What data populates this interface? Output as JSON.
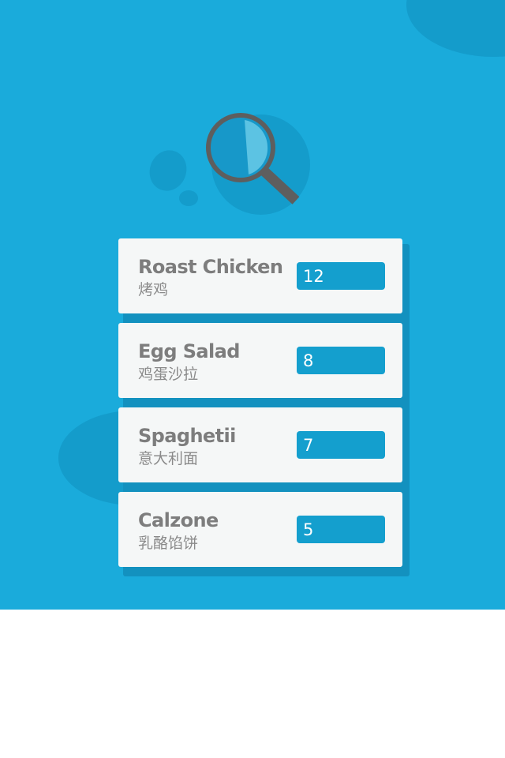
{
  "colors": {
    "background": "#ffffff",
    "hero_background": "#1aabdb",
    "blob": "#149ccb",
    "card_background": "#f5f7f7",
    "card_shadow": "#1391bf",
    "card_title_text": "#7d7d7d",
    "card_subtitle_text": "#8a8a8a",
    "field_background": "#149fce",
    "field_text": "#ffffff",
    "magnifier_frame": "#5e5e5e",
    "magnifier_glass": "#1798c9",
    "magnifier_glare": "#5cc3e3"
  },
  "icons": {
    "magnifier": "magnifying-glass-icon"
  },
  "items": [
    {
      "name": "Roast Chicken",
      "subname": "烤鸡",
      "quantity": "12"
    },
    {
      "name": "Egg Salad",
      "subname": "鸡蛋沙拉",
      "quantity": "8"
    },
    {
      "name": "Spaghetii",
      "subname": "意大利面",
      "quantity": "7"
    },
    {
      "name": "Calzone",
      "subname": "乳酪馅饼",
      "quantity": "5"
    }
  ]
}
